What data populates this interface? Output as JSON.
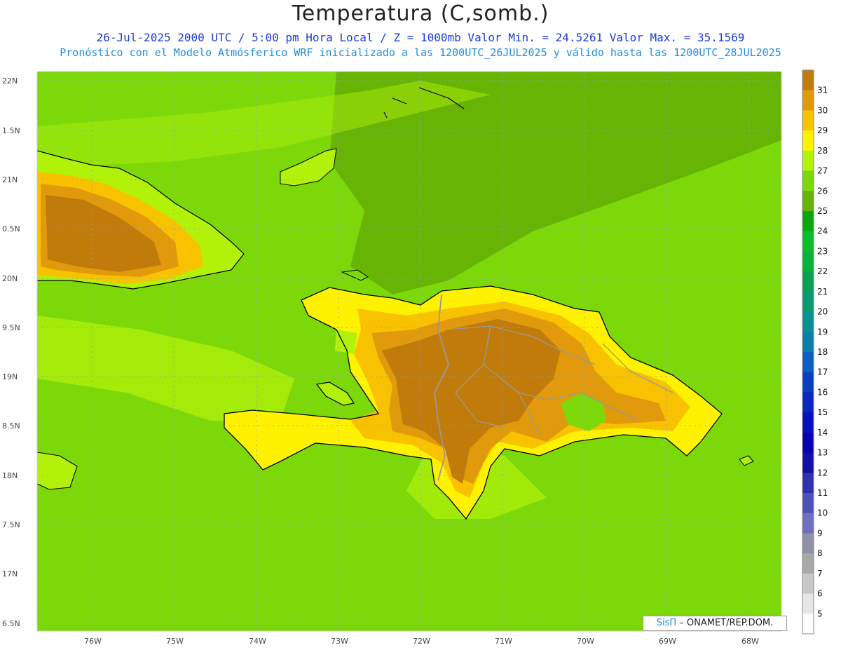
{
  "title": "Temperatura (C,somb.)",
  "subtitle_line1": "26-Jul-2025  2000 UTC / 5:00 pm Hora Local / Z = 1000mb   Valor Min. = 24.5261  Valor Max. = 35.1569",
  "subtitle_line2": "Pronóstico con el Modelo Atmósferico WRF inicializado a las 1200UTC_26JUL2025 y válido hasta las  1200UTC_28JUL2025",
  "credit": {
    "brand": "SisΠ",
    "text": " – ONAMET/REP.DOM."
  },
  "colors": {
    "sea": "#7dd80a",
    "sea_dark": "#68b404",
    "warm": "#b2f20a",
    "yellow": "#fff200",
    "orange": "#f9c200",
    "amber": "#e19a0b",
    "brown": "#c07b0a"
  },
  "lat_labels": [
    "22N",
    "1.5N",
    "21N",
    "0.5N",
    "20N",
    "9.5N",
    "19N",
    "8.5N",
    "18N",
    "7.5N",
    "17N",
    "6.5N"
  ],
  "lon_labels": [
    "76W",
    "75W",
    "74W",
    "73W",
    "72W",
    "71W",
    "70W",
    "69W",
    "68W"
  ],
  "colorbar": {
    "labels": [
      "31",
      "30",
      "29",
      "28",
      "27",
      "26",
      "25",
      "24",
      "23",
      "22",
      "21",
      "20",
      "19",
      "18",
      "17",
      "16",
      "15",
      "14",
      "13",
      "12",
      "11",
      "10",
      "9",
      "8",
      "7",
      "6",
      "5"
    ],
    "colors": [
      "#c07b0a",
      "#e19a0b",
      "#f9c200",
      "#fff200",
      "#b2f20a",
      "#7dd80a",
      "#68b404",
      "#0aa80a",
      "#0abf2a",
      "#0ab23c",
      "#0aa054",
      "#0a9a70",
      "#0a9090",
      "#0a80a8",
      "#0a60c0",
      "#0a40c0",
      "#0a28c0",
      "#0a10c0",
      "#0a00b0",
      "#1010a8",
      "#3030b0",
      "#5050b8",
      "#7070c0",
      "#9090a8",
      "#a8a8a8",
      "#c8c8c8",
      "#e6e6e6",
      "#ffffff"
    ]
  }
}
